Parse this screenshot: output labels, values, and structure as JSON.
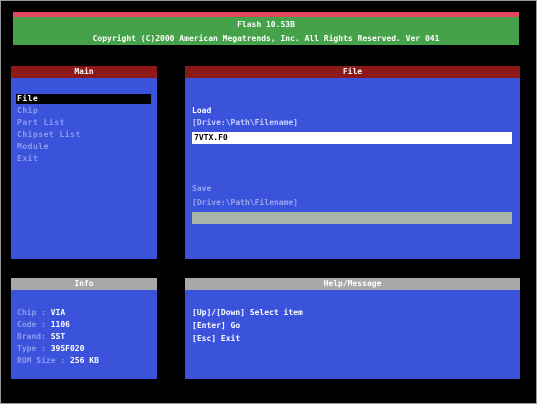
{
  "header": {
    "title": "Flash 10.S3B",
    "copyright": "Copyright (C)2000 American Megatrends, Inc. All Rights Reserved. Ver 041"
  },
  "main": {
    "title": "Main",
    "items": [
      {
        "label": "File",
        "selected": true
      },
      {
        "label": "Chip",
        "selected": false
      },
      {
        "label": "Part List",
        "selected": false
      },
      {
        "label": "Chipset List",
        "selected": false
      },
      {
        "label": "Module",
        "selected": false
      },
      {
        "label": "Exit",
        "selected": false
      }
    ]
  },
  "file": {
    "title": "File",
    "load_label": "Load",
    "load_path_hint": "[Drive:\\Path\\Filename]",
    "load_value": "7VTX.F0",
    "save_label": "Save",
    "save_path_hint": "[Drive:\\Path\\Filename]",
    "save_value": ""
  },
  "info": {
    "title": "Info",
    "rows": [
      {
        "key": "Chip : ",
        "value": "VIA"
      },
      {
        "key": "Code : ",
        "value": "1106"
      },
      {
        "key": "Brand: ",
        "value": "SST"
      },
      {
        "key": "Type : ",
        "value": "39SF020"
      },
      {
        "key": "ROM Size : ",
        "value": "256 KB"
      }
    ]
  },
  "help": {
    "title": "Help/Message",
    "lines": [
      "[Up]/[Down] Select item",
      "[Enter] Go",
      "[Esc] Exit"
    ]
  },
  "colors": {
    "panel_blue": "#3b52db",
    "header_green": "#46a24a",
    "header_red": "#e0475c",
    "panel_title_red": "#8c1818",
    "panel_title_grey": "#a8a8a8"
  }
}
